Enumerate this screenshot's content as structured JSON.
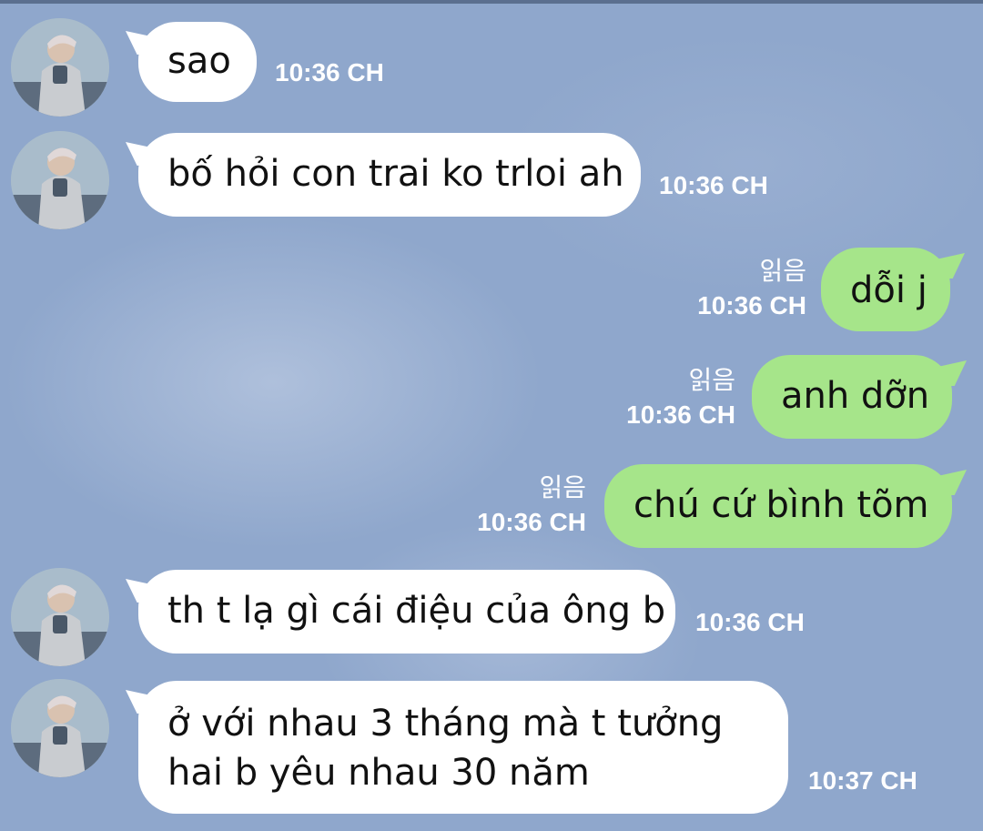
{
  "chat": {
    "messages": [
      {
        "side": "in",
        "text": "sao",
        "time": "10:36 CH"
      },
      {
        "side": "in",
        "text": "bố hỏi con trai ko trloi ah",
        "time": "10:36 CH"
      },
      {
        "side": "out",
        "text": "dỗi j",
        "time": "10:36 CH",
        "read": "읽음"
      },
      {
        "side": "out",
        "text": "anh dỡn",
        "time": "10:36 CH",
        "read": "읽음"
      },
      {
        "side": "out",
        "text": "chú cứ bình tõm",
        "time": "10:36 CH",
        "read": "읽음"
      },
      {
        "side": "in",
        "text": "th t lạ gì cái điệu của ông b",
        "time": "10:36 CH"
      },
      {
        "side": "in",
        "lines": [
          "ở với nhau 3 tháng mà t tưởng",
          "hai b yêu nhau 30 năm"
        ],
        "time": "10:37 CH"
      }
    ]
  },
  "colors": {
    "incoming": "#ffffff",
    "outgoing": "#a6e58a",
    "background": "#8fa7cc"
  },
  "icons": {
    "avatar": "contact-photo"
  }
}
